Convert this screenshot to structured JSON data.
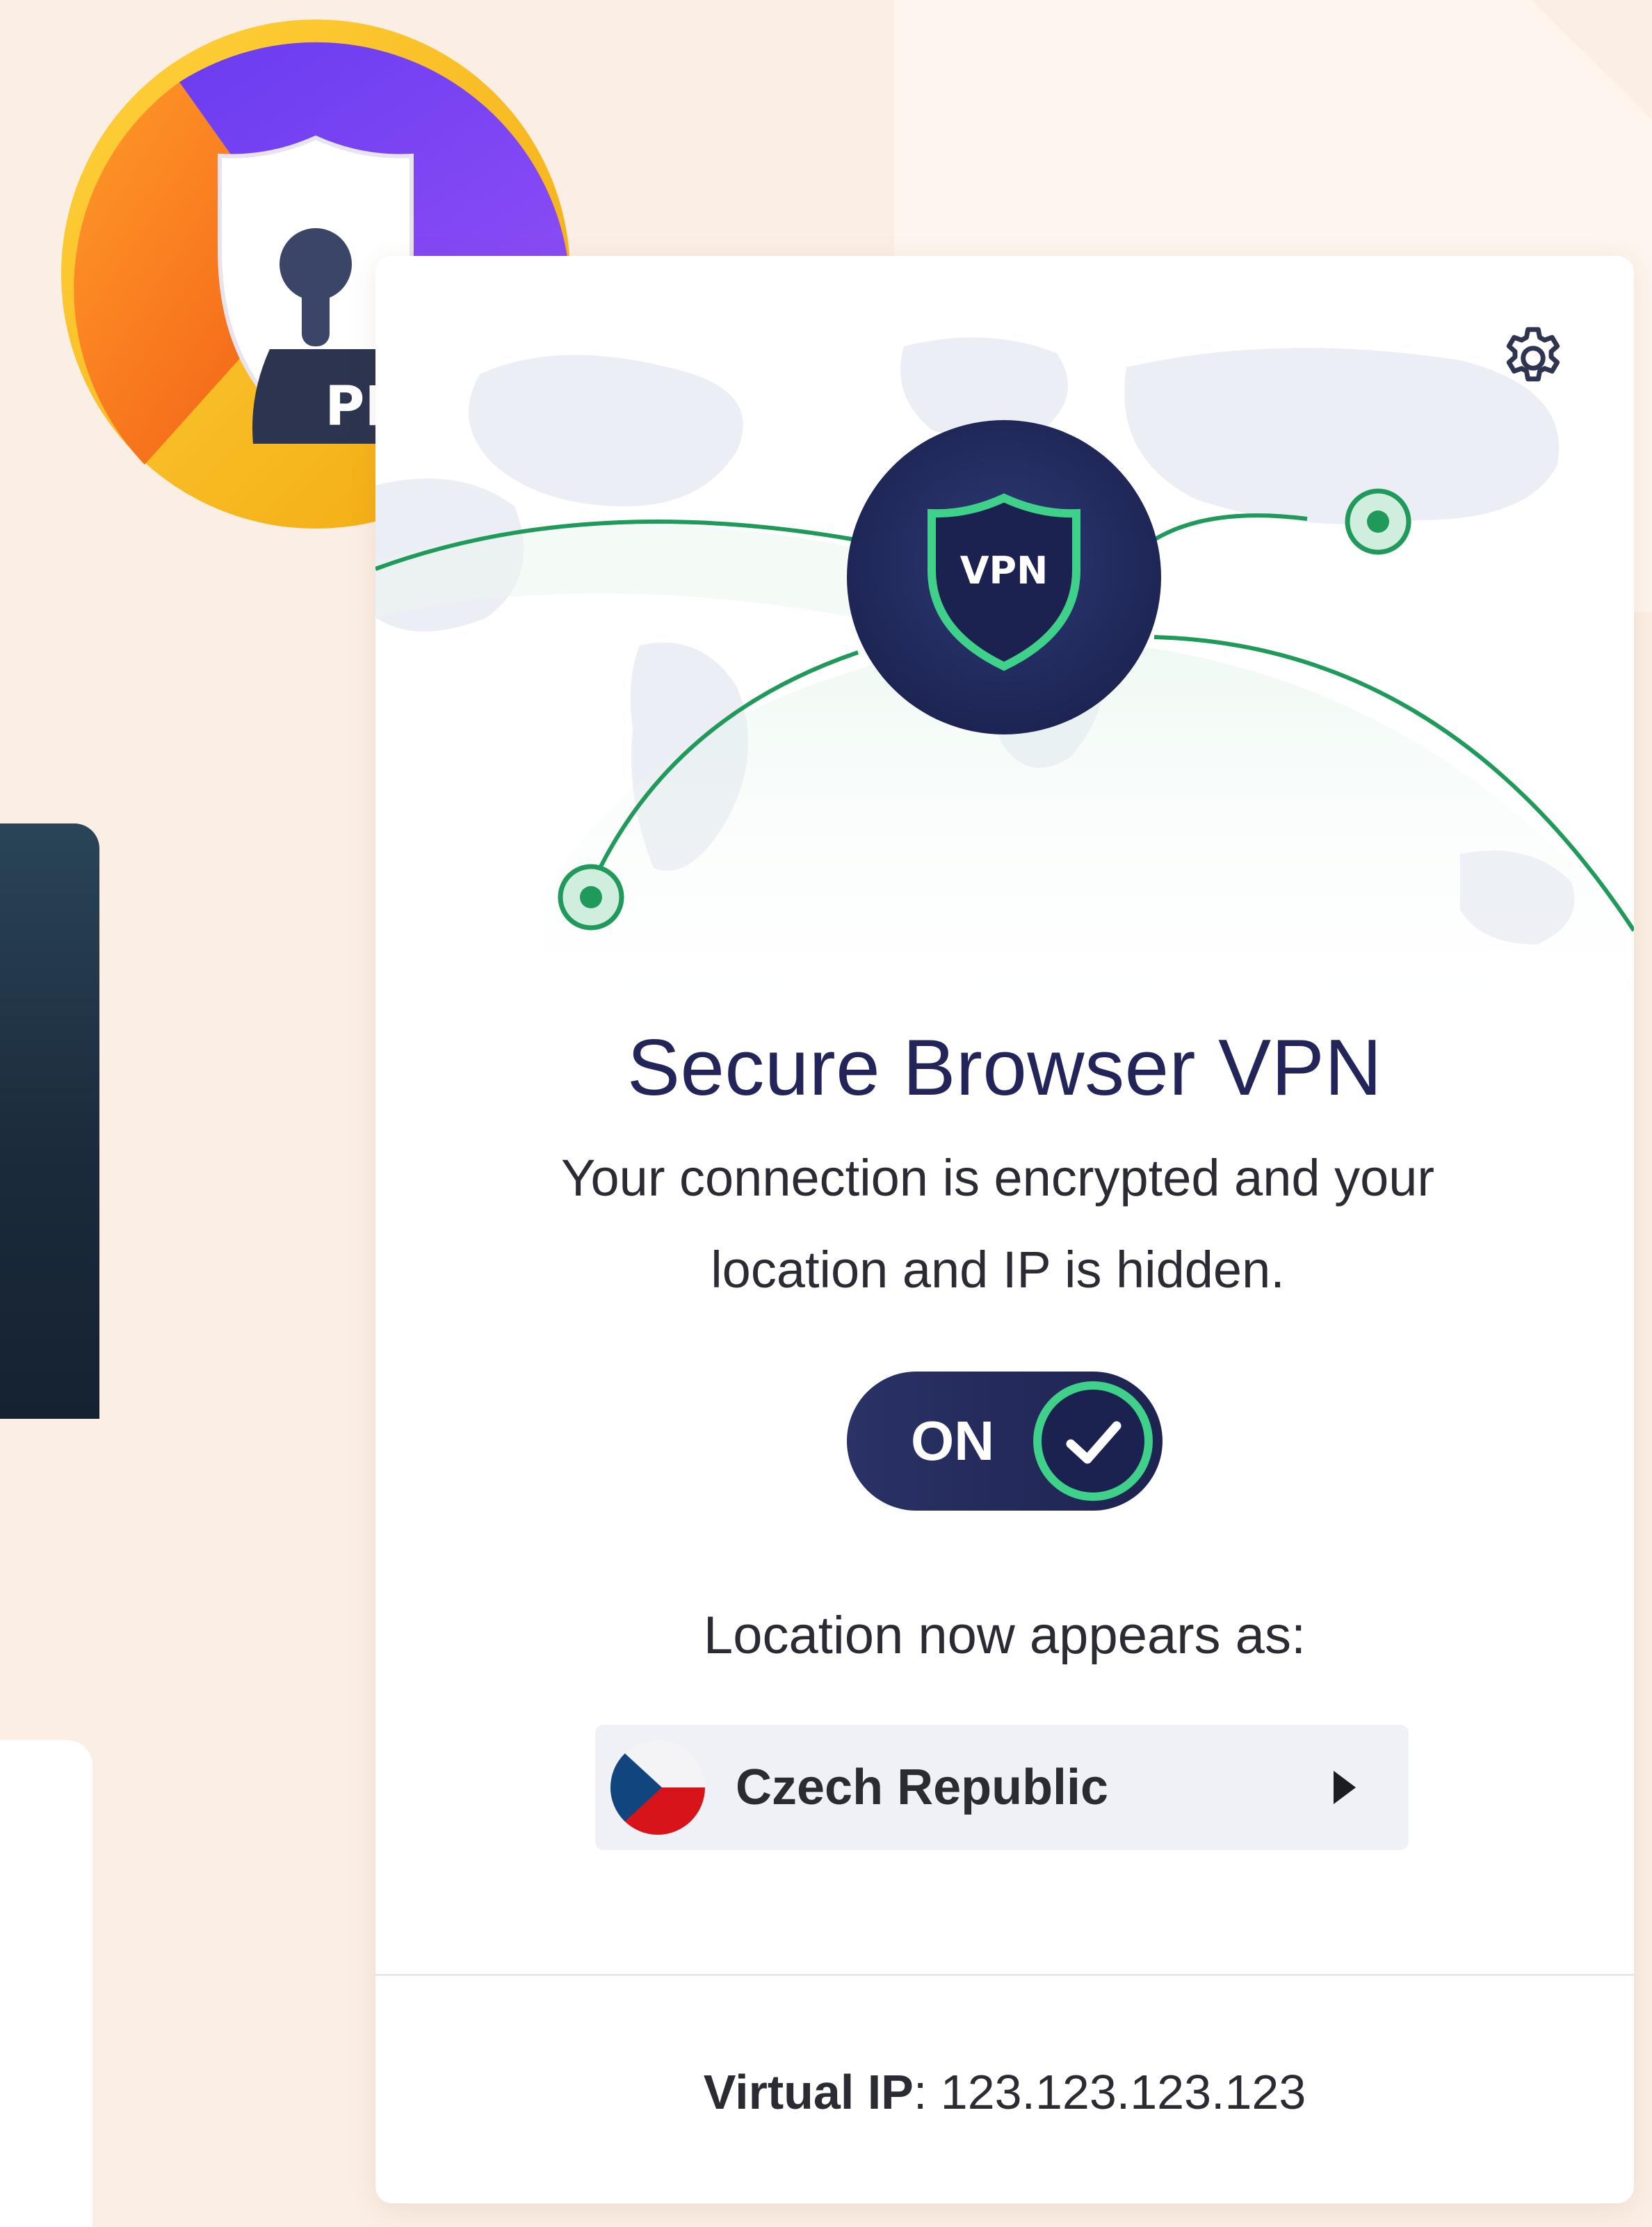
{
  "badge": {
    "label": "PRO",
    "icon": "avast-secure-browser-pro-logo"
  },
  "vpn_panel": {
    "settings_icon": "gear-icon",
    "hub_label": "VPN",
    "title": "Secure Browser VPN",
    "description_line1": "Your connection is encrypted and your",
    "description_line2": "location and IP is hidden.",
    "toggle": {
      "label": "ON",
      "state": true
    },
    "location_label": "Location now appears as:",
    "location": {
      "country": "Czech Republic",
      "flag": "czech-flag-icon"
    },
    "virtual_ip": {
      "label": "Virtual IP",
      "separator": ":",
      "value": " 123.123.123.123"
    }
  },
  "colors": {
    "accent_navy": "#23245a",
    "connection_green": "#1f9a5a",
    "page_bg": "#fbeee4"
  }
}
